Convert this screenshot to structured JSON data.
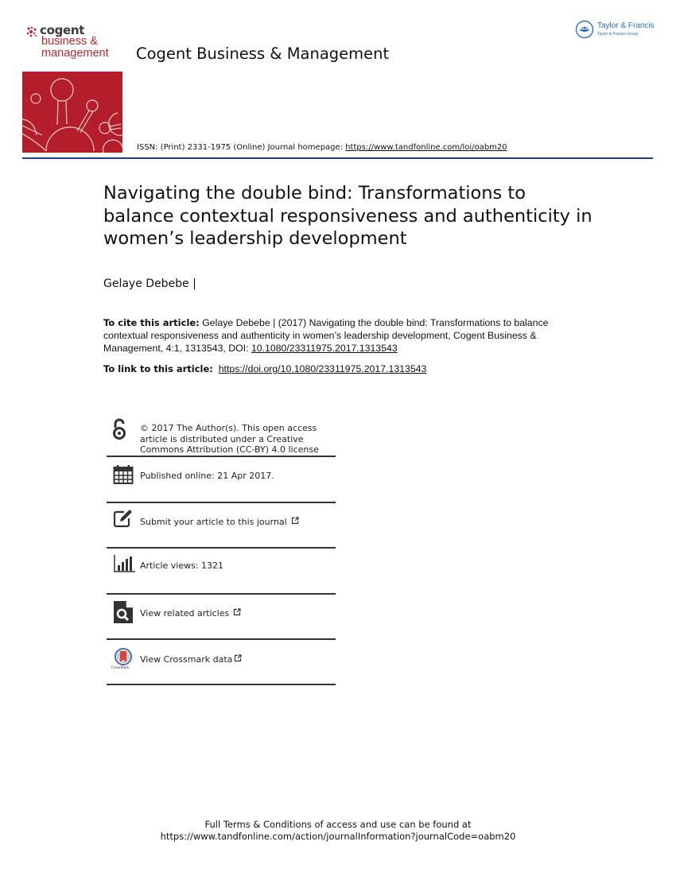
{
  "header": {
    "logo": {
      "brand": "cogent",
      "subtitle_line1": "business &",
      "subtitle_line2": "management"
    },
    "journal_title": "Cogent Business & Management",
    "publisher": {
      "name": "Taylor & Francis",
      "group": "Taylor & Francis Group"
    },
    "issn_text": "ISSN: (Print) 2331-1975 (Online) Journal homepage: ",
    "homepage_url": "https://www.tandfonline.com/loi/oabm20"
  },
  "article": {
    "title": "Navigating the double bind: Transformations to balance contextual responsiveness and authenticity in women’s leadership development",
    "author": "Gelaye Debebe |",
    "cite_label": "To cite this article:",
    "cite_text": " Gelaye Debebe | (2017) Navigating the double bind: Transformations to balance contextual responsiveness and authenticity in women’s leadership development, Cogent Business & Management, 4:1, 1313543, DOI: ",
    "cite_doi": "10.1080/23311975.2017.1313543",
    "link_label": "To link to this article:",
    "link_url": "https://doi.org/10.1080/23311975.2017.1313543"
  },
  "info_items": [
    {
      "icon": "open-access-icon",
      "text": "© 2017 The Author(s). This open access article is distributed under a Creative Commons Attribution (CC-BY) 4.0 license"
    },
    {
      "icon": "calendar-icon",
      "text": "Published online: 21 Apr 2017."
    },
    {
      "icon": "edit-icon",
      "text": "Submit your article to this journal"
    },
    {
      "icon": "bar-chart-icon",
      "text": "Article views: 1321"
    },
    {
      "icon": "search-document-icon",
      "text": "View related articles"
    },
    {
      "icon": "crossmark-icon",
      "text": "View Crossmark data",
      "icon_caption": "CrossMark"
    }
  ],
  "footer": {
    "line1": "Full Terms & Conditions of access and use can be found at",
    "line2": "https://www.tandfonline.com/action/journalInformation?journalCode=oabm20"
  },
  "colors": {
    "brand_red": "#b31e2a",
    "rule_blue": "#1d3b8a",
    "tf_blue": "#2a6ec7"
  }
}
